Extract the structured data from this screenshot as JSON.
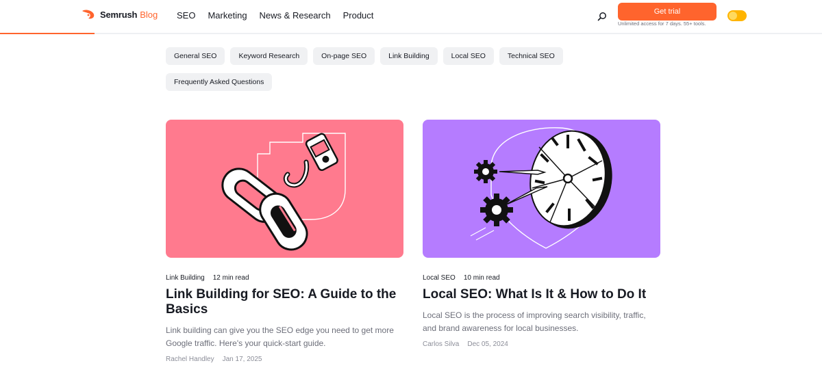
{
  "header": {
    "logo_name": "Semrush",
    "logo_sub": "Blog",
    "nav": [
      "SEO",
      "Marketing",
      "News & Research",
      "Product"
    ],
    "cta_label": "Get trial",
    "cta_note": "Unlimited access for 7 days. 55+ tools.",
    "reading_progress": 0.115
  },
  "categories": [
    "General SEO",
    "Keyword Research",
    "On-page SEO",
    "Link Building",
    "Local SEO",
    "Technical SEO",
    "Frequently Asked Questions"
  ],
  "articles": [
    {
      "category": "Link Building",
      "read_time": "12 min read",
      "title": "Link Building for SEO: A Guide to the Basics",
      "excerpt": "Link building can give you the SEO edge you need to get more Google traffic. Here's your quick-start guide.",
      "author": "Rachel Handley",
      "date": "Jan 17, 2025",
      "image_bg": "#ff7a8e",
      "image_icon": "chain-hook-illustration"
    },
    {
      "category": "Local SEO",
      "read_time": "10 min read",
      "title": "Local SEO: What Is It & How to Do It",
      "excerpt": "Local SEO is the process of improving search visibility, traffic, and brand awareness for local businesses.",
      "author": "Carlos Silva",
      "date": "Dec 05, 2024",
      "image_bg": "#b57cff",
      "image_icon": "map-target-gears-illustration"
    }
  ],
  "colors": {
    "accent": "#ff642d",
    "chip_bg": "#f0f1f3",
    "toggle": "#ffb400"
  }
}
